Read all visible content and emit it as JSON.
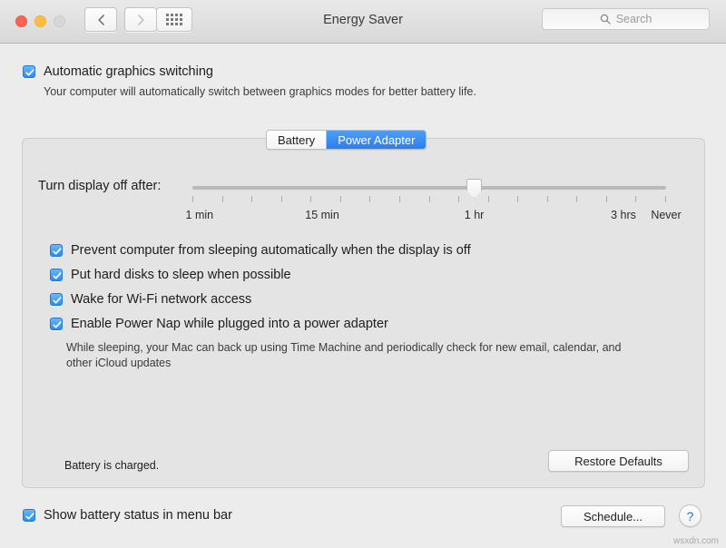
{
  "window": {
    "title": "Energy Saver",
    "traffic_lights": [
      "close",
      "minimize",
      "zoom"
    ],
    "nav": {
      "back_icon": "chevron-left-icon",
      "forward_icon": "chevron-right-icon"
    },
    "grid_button_icon": "grid-apps-icon",
    "search": {
      "placeholder": "Search",
      "value": "",
      "icon": "search-icon"
    }
  },
  "graphics": {
    "checkbox_label": "Automatic graphics switching",
    "checked": true,
    "description": "Your computer will automatically switch between graphics modes for better battery life."
  },
  "tabs": [
    {
      "label": "Battery",
      "active": false
    },
    {
      "label": "Power Adapter",
      "active": true
    }
  ],
  "slider": {
    "label": "Turn display off after:",
    "value_label": "1 hr",
    "tick_count": 17,
    "thumb_position_pct": 59.5,
    "tick_labels": [
      {
        "text": "1 min",
        "x_pct": 1.5
      },
      {
        "text": "15 min",
        "x_pct": 27.4
      },
      {
        "text": "1 hr",
        "x_pct": 59.5
      },
      {
        "text": "3 hrs",
        "x_pct": 91.0
      },
      {
        "text": "Never",
        "x_pct": 100.0
      }
    ]
  },
  "options": [
    {
      "label": "Prevent computer from sleeping automatically when the display is off",
      "checked": true
    },
    {
      "label": "Put hard disks to sleep when possible",
      "checked": true
    },
    {
      "label": "Wake for Wi-Fi network access",
      "checked": true
    },
    {
      "label": "Enable Power Nap while plugged into a power adapter",
      "checked": true
    }
  ],
  "power_nap_description": "While sleeping, your Mac can back up using Time Machine and periodically check for new email, calendar, and other iCloud updates",
  "battery_status": "Battery is charged.",
  "restore_defaults_label": "Restore Defaults",
  "footer": {
    "menu_bar_checkbox_label": "Show battery status in menu bar",
    "menu_bar_checked": true,
    "schedule_label": "Schedule...",
    "help_label": "?"
  },
  "watermark": "wsxdn.com",
  "colors": {
    "accent_blue": "#2b7ef0",
    "window_bg": "#ececec",
    "panel_bg": "#e4e4e4"
  }
}
